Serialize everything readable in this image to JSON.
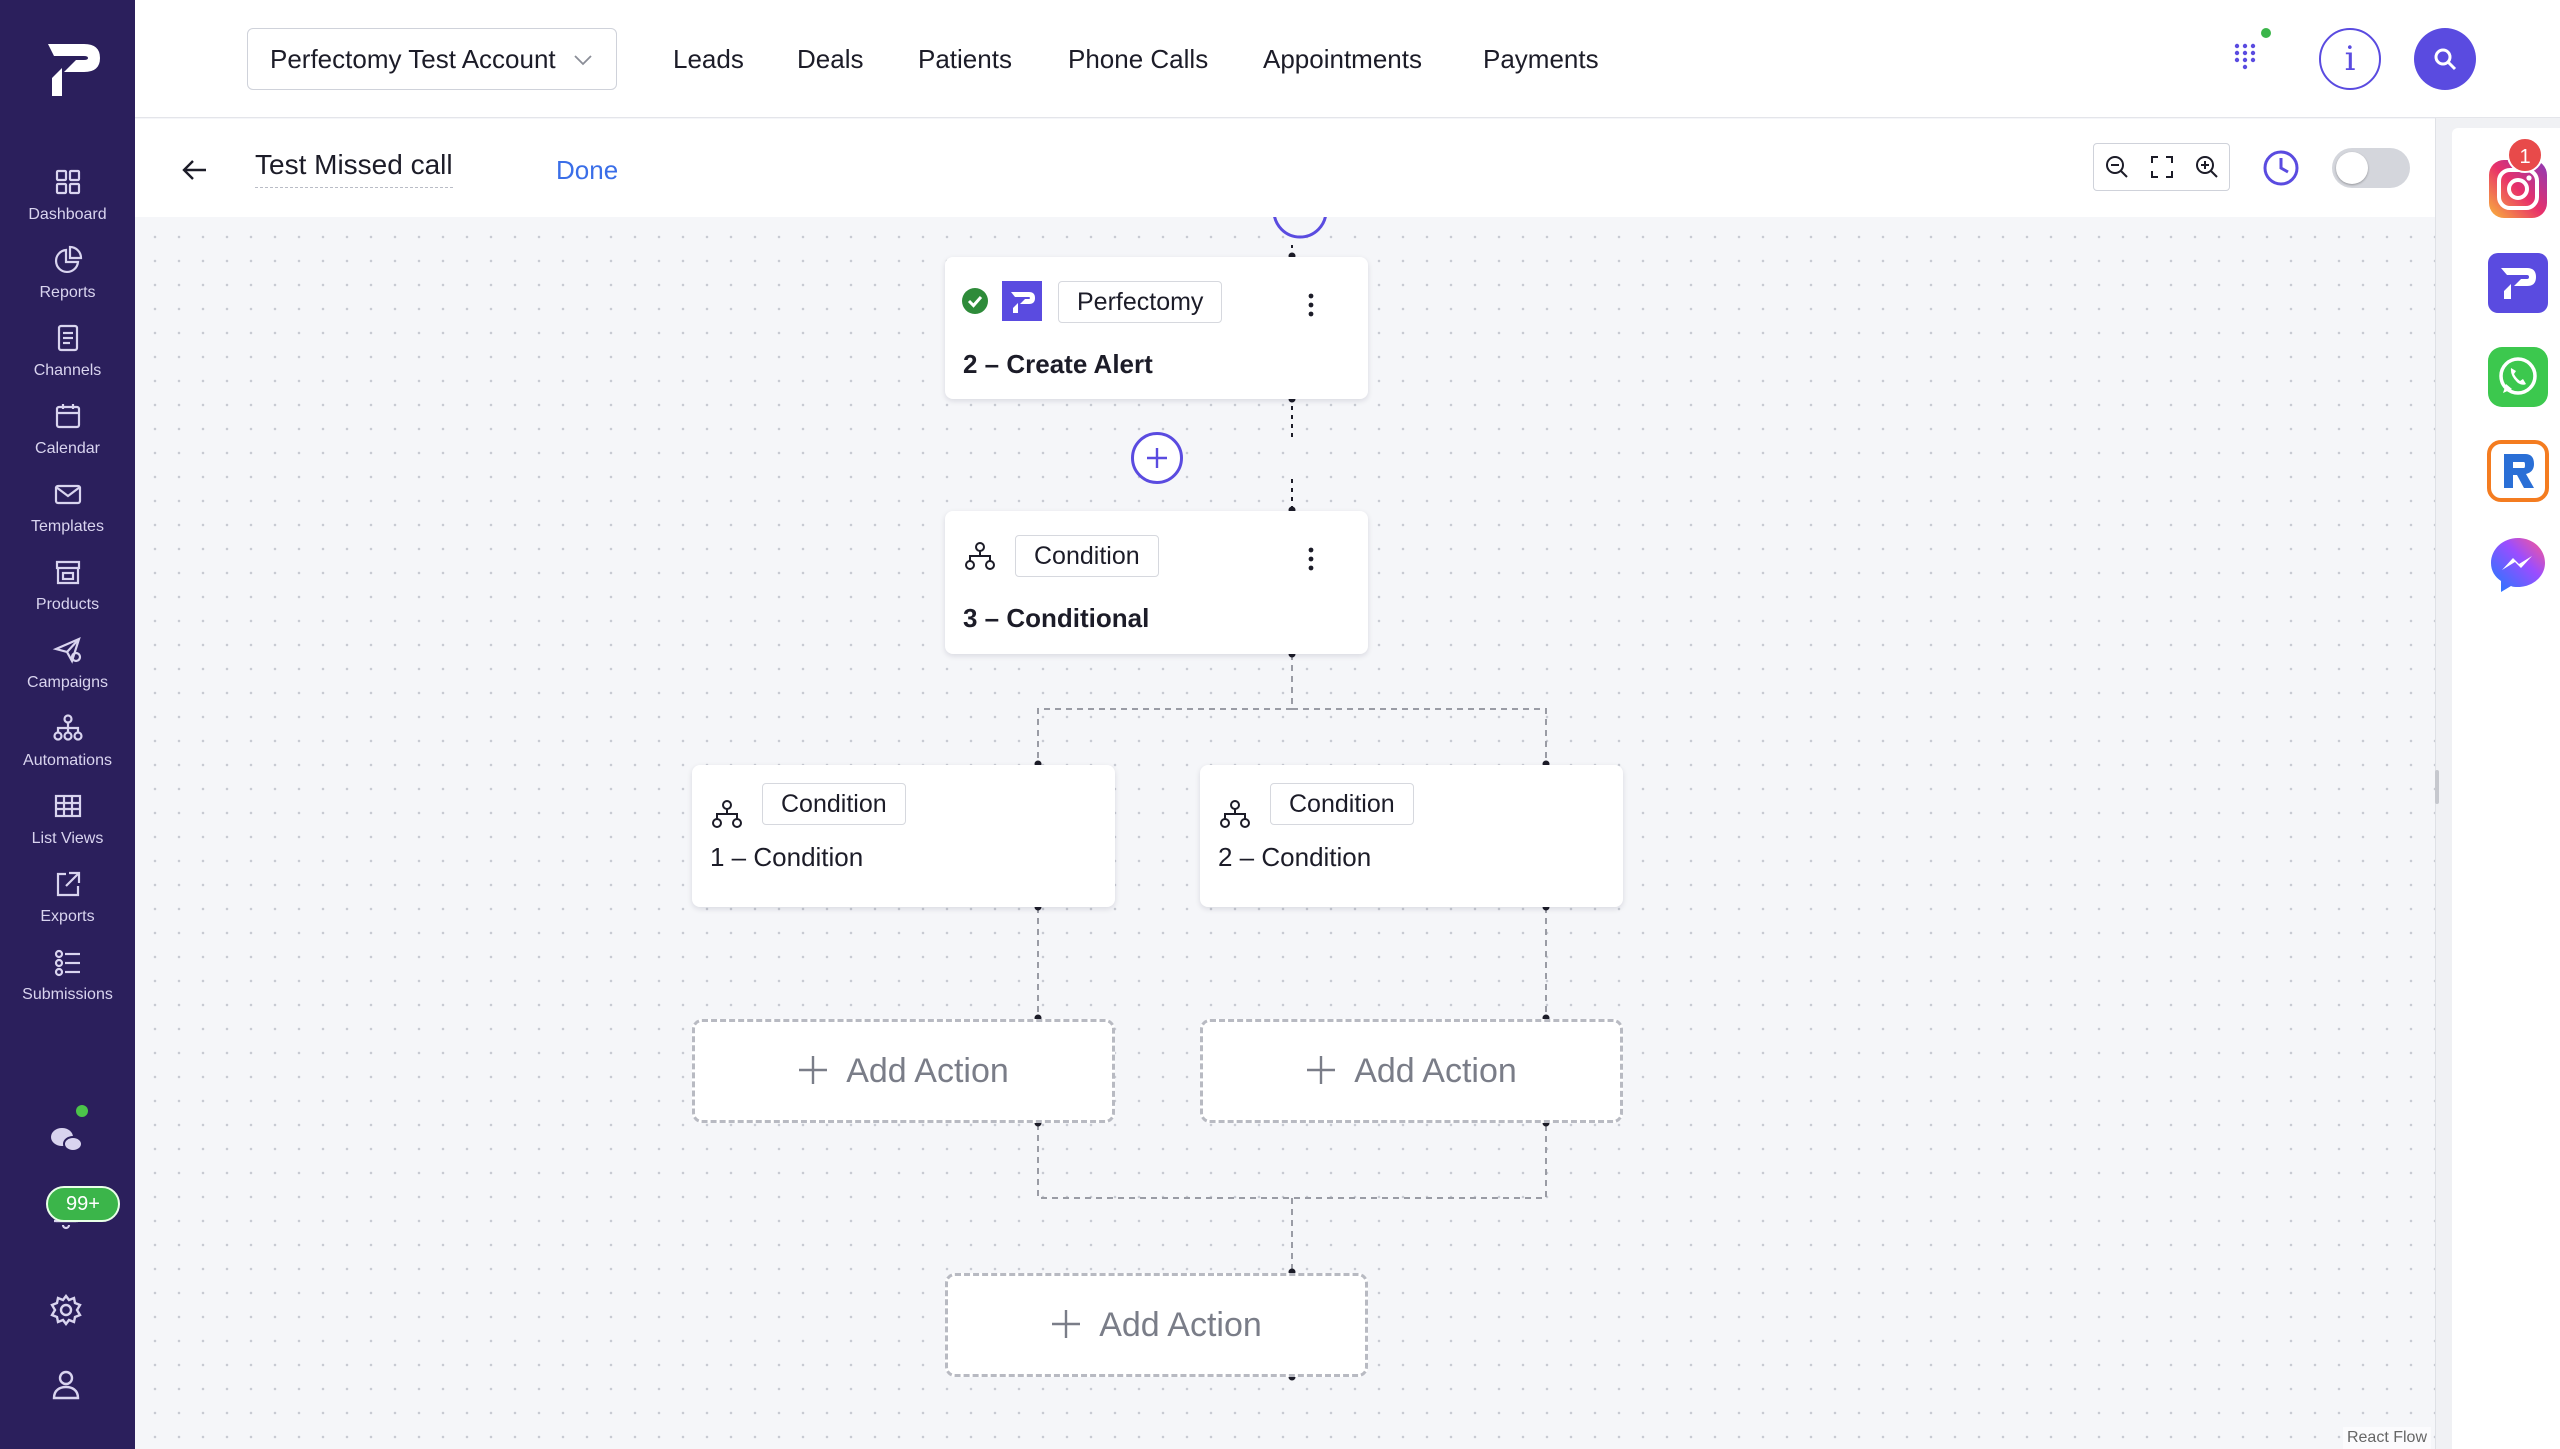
{
  "topbar": {
    "account": "Perfectomy Test Account",
    "nav": [
      "Leads",
      "Deals",
      "Patients",
      "Phone Calls",
      "Appointments",
      "Payments"
    ],
    "info_label": "i"
  },
  "sidebar": {
    "items": [
      {
        "label": "Dashboard",
        "icon": "dashboard-icon"
      },
      {
        "label": "Reports",
        "icon": "pie-chart-icon"
      },
      {
        "label": "Channels",
        "icon": "document-icon"
      },
      {
        "label": "Calendar",
        "icon": "calendar-icon"
      },
      {
        "label": "Templates",
        "icon": "mail-icon"
      },
      {
        "label": "Products",
        "icon": "store-icon"
      },
      {
        "label": "Campaigns",
        "icon": "send-icon"
      },
      {
        "label": "Automations",
        "icon": "hierarchy-icon"
      },
      {
        "label": "List Views",
        "icon": "grid-table-icon"
      },
      {
        "label": "Exports",
        "icon": "export-icon"
      },
      {
        "label": "Submissions",
        "icon": "list-check-icon"
      }
    ],
    "notification_count": "99+"
  },
  "flow": {
    "title": "Test Missed call",
    "done_label": "Done"
  },
  "nodes": {
    "alert": {
      "tag": "Perfectomy",
      "title": "2 – Create Alert"
    },
    "conditional": {
      "tag": "Condition",
      "title": "3 – Conditional"
    },
    "cond1": {
      "tag": "Condition",
      "title": "1 – Condition"
    },
    "cond2": {
      "tag": "Condition",
      "title": "2 – Condition"
    }
  },
  "add_action_label": "Add Action",
  "attribution": "React Flow",
  "rail": {
    "apps": [
      "instagram-icon",
      "perfectomy-icon",
      "whatsapp-icon",
      "rc-icon",
      "messenger-icon"
    ],
    "instagram_badge": "1"
  },
  "colors": {
    "sidebar": "#2b1f5c",
    "accent": "#5a4be0",
    "link": "#3a6ee8",
    "success": "#3bb54a",
    "badge": "#e84a4a"
  }
}
